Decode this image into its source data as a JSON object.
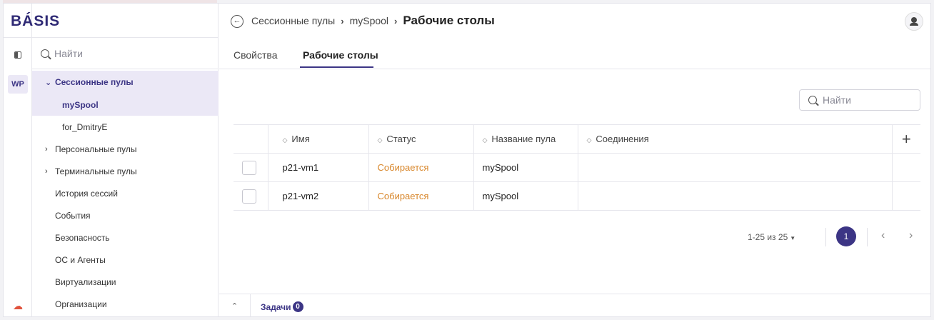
{
  "brand": {
    "logo_text": "BÁSIS"
  },
  "rail": {
    "wp_badge": "WP"
  },
  "sidebar": {
    "search_placeholder": "Найти",
    "items": [
      {
        "label": "Сессионные пулы"
      },
      {
        "label": "mySpool"
      },
      {
        "label": "for_DmitryE"
      },
      {
        "label": "Персональные пулы"
      },
      {
        "label": "Терминальные пулы"
      },
      {
        "label": "История сессий"
      },
      {
        "label": "События"
      },
      {
        "label": "Безопасность"
      },
      {
        "label": "ОС и Агенты"
      },
      {
        "label": "Виртуализации"
      },
      {
        "label": "Организации"
      }
    ]
  },
  "header": {
    "breadcrumb": [
      "Сессионные пулы",
      "mySpool"
    ],
    "title": "Рабочие столы"
  },
  "tabs": [
    {
      "label": "Свойства"
    },
    {
      "label": "Рабочие столы"
    }
  ],
  "table": {
    "search_placeholder": "Найти",
    "columns": [
      "Имя",
      "Статус",
      "Название пула",
      "Соединения"
    ],
    "add_label": "+",
    "rows": [
      {
        "name": "p21-vm1",
        "status": "Собирается",
        "pool": "mySpool",
        "connections": ""
      },
      {
        "name": "p21-vm2",
        "status": "Собирается",
        "pool": "mySpool",
        "connections": ""
      }
    ]
  },
  "pagination": {
    "range_text": "1-25 из 25",
    "current_page": "1"
  },
  "footer": {
    "tasks_label": "Задачи",
    "tasks_count": "0"
  },
  "colors": {
    "accent": "#3c3585",
    "status_building": "#d8862a",
    "selected_bg": "#ebe8f6"
  },
  "icons": [
    "panel-toggle-icon",
    "search-icon",
    "chevron-down-icon",
    "chevron-right-icon",
    "back-icon",
    "user-icon",
    "sort-icon",
    "plus-icon",
    "caret-down-icon",
    "chevron-left-icon",
    "chevron-up-icon",
    "cloud-icon"
  ]
}
